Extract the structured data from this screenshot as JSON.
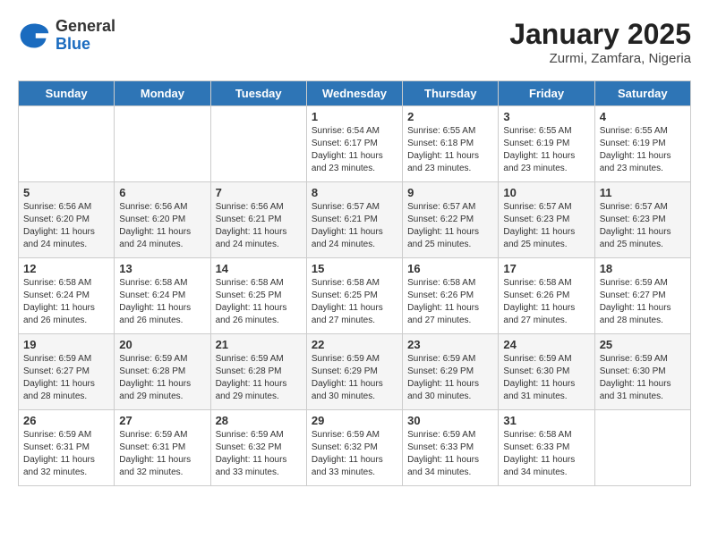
{
  "header": {
    "logo_general": "General",
    "logo_blue": "Blue",
    "month_title": "January 2025",
    "location": "Zurmi, Zamfara, Nigeria"
  },
  "days_of_week": [
    "Sunday",
    "Monday",
    "Tuesday",
    "Wednesday",
    "Thursday",
    "Friday",
    "Saturday"
  ],
  "weeks": [
    [
      {
        "day": "",
        "info": ""
      },
      {
        "day": "",
        "info": ""
      },
      {
        "day": "",
        "info": ""
      },
      {
        "day": "1",
        "info": "Sunrise: 6:54 AM\nSunset: 6:17 PM\nDaylight: 11 hours\nand 23 minutes."
      },
      {
        "day": "2",
        "info": "Sunrise: 6:55 AM\nSunset: 6:18 PM\nDaylight: 11 hours\nand 23 minutes."
      },
      {
        "day": "3",
        "info": "Sunrise: 6:55 AM\nSunset: 6:19 PM\nDaylight: 11 hours\nand 23 minutes."
      },
      {
        "day": "4",
        "info": "Sunrise: 6:55 AM\nSunset: 6:19 PM\nDaylight: 11 hours\nand 23 minutes."
      }
    ],
    [
      {
        "day": "5",
        "info": "Sunrise: 6:56 AM\nSunset: 6:20 PM\nDaylight: 11 hours\nand 24 minutes."
      },
      {
        "day": "6",
        "info": "Sunrise: 6:56 AM\nSunset: 6:20 PM\nDaylight: 11 hours\nand 24 minutes."
      },
      {
        "day": "7",
        "info": "Sunrise: 6:56 AM\nSunset: 6:21 PM\nDaylight: 11 hours\nand 24 minutes."
      },
      {
        "day": "8",
        "info": "Sunrise: 6:57 AM\nSunset: 6:21 PM\nDaylight: 11 hours\nand 24 minutes."
      },
      {
        "day": "9",
        "info": "Sunrise: 6:57 AM\nSunset: 6:22 PM\nDaylight: 11 hours\nand 25 minutes."
      },
      {
        "day": "10",
        "info": "Sunrise: 6:57 AM\nSunset: 6:23 PM\nDaylight: 11 hours\nand 25 minutes."
      },
      {
        "day": "11",
        "info": "Sunrise: 6:57 AM\nSunset: 6:23 PM\nDaylight: 11 hours\nand 25 minutes."
      }
    ],
    [
      {
        "day": "12",
        "info": "Sunrise: 6:58 AM\nSunset: 6:24 PM\nDaylight: 11 hours\nand 26 minutes."
      },
      {
        "day": "13",
        "info": "Sunrise: 6:58 AM\nSunset: 6:24 PM\nDaylight: 11 hours\nand 26 minutes."
      },
      {
        "day": "14",
        "info": "Sunrise: 6:58 AM\nSunset: 6:25 PM\nDaylight: 11 hours\nand 26 minutes."
      },
      {
        "day": "15",
        "info": "Sunrise: 6:58 AM\nSunset: 6:25 PM\nDaylight: 11 hours\nand 27 minutes."
      },
      {
        "day": "16",
        "info": "Sunrise: 6:58 AM\nSunset: 6:26 PM\nDaylight: 11 hours\nand 27 minutes."
      },
      {
        "day": "17",
        "info": "Sunrise: 6:58 AM\nSunset: 6:26 PM\nDaylight: 11 hours\nand 27 minutes."
      },
      {
        "day": "18",
        "info": "Sunrise: 6:59 AM\nSunset: 6:27 PM\nDaylight: 11 hours\nand 28 minutes."
      }
    ],
    [
      {
        "day": "19",
        "info": "Sunrise: 6:59 AM\nSunset: 6:27 PM\nDaylight: 11 hours\nand 28 minutes."
      },
      {
        "day": "20",
        "info": "Sunrise: 6:59 AM\nSunset: 6:28 PM\nDaylight: 11 hours\nand 29 minutes."
      },
      {
        "day": "21",
        "info": "Sunrise: 6:59 AM\nSunset: 6:28 PM\nDaylight: 11 hours\nand 29 minutes."
      },
      {
        "day": "22",
        "info": "Sunrise: 6:59 AM\nSunset: 6:29 PM\nDaylight: 11 hours\nand 30 minutes."
      },
      {
        "day": "23",
        "info": "Sunrise: 6:59 AM\nSunset: 6:29 PM\nDaylight: 11 hours\nand 30 minutes."
      },
      {
        "day": "24",
        "info": "Sunrise: 6:59 AM\nSunset: 6:30 PM\nDaylight: 11 hours\nand 31 minutes."
      },
      {
        "day": "25",
        "info": "Sunrise: 6:59 AM\nSunset: 6:30 PM\nDaylight: 11 hours\nand 31 minutes."
      }
    ],
    [
      {
        "day": "26",
        "info": "Sunrise: 6:59 AM\nSunset: 6:31 PM\nDaylight: 11 hours\nand 32 minutes."
      },
      {
        "day": "27",
        "info": "Sunrise: 6:59 AM\nSunset: 6:31 PM\nDaylight: 11 hours\nand 32 minutes."
      },
      {
        "day": "28",
        "info": "Sunrise: 6:59 AM\nSunset: 6:32 PM\nDaylight: 11 hours\nand 33 minutes."
      },
      {
        "day": "29",
        "info": "Sunrise: 6:59 AM\nSunset: 6:32 PM\nDaylight: 11 hours\nand 33 minutes."
      },
      {
        "day": "30",
        "info": "Sunrise: 6:59 AM\nSunset: 6:33 PM\nDaylight: 11 hours\nand 34 minutes."
      },
      {
        "day": "31",
        "info": "Sunrise: 6:58 AM\nSunset: 6:33 PM\nDaylight: 11 hours\nand 34 minutes."
      },
      {
        "day": "",
        "info": ""
      }
    ]
  ]
}
